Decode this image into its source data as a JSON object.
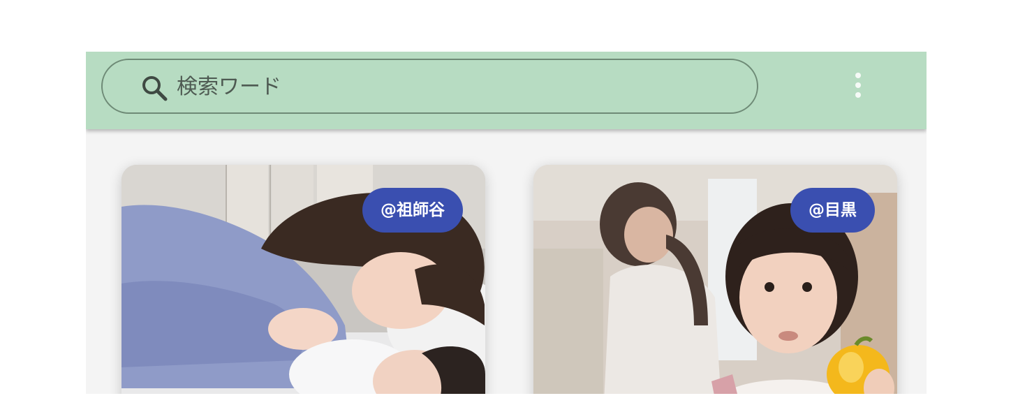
{
  "search": {
    "placeholder": "検索ワード",
    "icon": "search-icon"
  },
  "header": {
    "background_color": "#b7dcc2",
    "menu_icon": "more-vert-icon"
  },
  "cards": [
    {
      "location": "@祖師谷",
      "photo": "mother-and-baby-photo"
    },
    {
      "location": "@目黒",
      "photo": "girl-with-pepper-photo"
    }
  ],
  "colors": {
    "badge": "#3a4fb0",
    "badge_text": "#ffffff"
  }
}
